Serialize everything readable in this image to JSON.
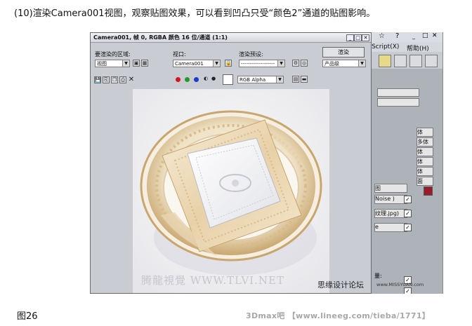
{
  "captions": {
    "top": "(10)渲染Camera001视图，观察贴图效果，可以看到凹凸只受“颜色2”通道的贴图影响。",
    "bottom": "图26",
    "footer": "3Dmax吧 【www.lineeg.com/tieba/1771】"
  },
  "render_window": {
    "title": "Camera001, 帧 0, RGBA 颜色 16 位/通道 (1:1)",
    "area_label": "要渲染的区域:",
    "area_value": "视图",
    "viewport_label": "视口:",
    "viewport_value": "Camera001",
    "preset_label": "渲染预设:",
    "preset_value": "-------------------",
    "render_button": "渲染",
    "quality_value": "产品级",
    "channel_value": "RGB Alpha",
    "watermark": "腾龍視覺 WWW.TLVI.NET",
    "colors": {
      "red": "#d8141d",
      "green": "#1f9a2a",
      "blue": "#1b3ad0"
    }
  },
  "background_app": {
    "menu_maxscript": "MAXScript(X)",
    "menu_help": "帮助(H)",
    "rollout_items": [
      "体",
      "多体",
      "体",
      "体",
      "体",
      "面"
    ],
    "list_items": [
      "图",
      "Noise )",
      "纹理.jpg)",
      "e"
    ],
    "bottom_label": "量:",
    "swatch_color": "#9a1c2c"
  },
  "overlay": {
    "text": "思缘设计论坛",
    "url": "www.MISSYUAN.com"
  }
}
